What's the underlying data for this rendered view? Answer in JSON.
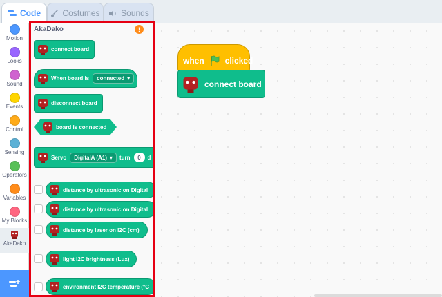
{
  "tabs": [
    {
      "label": "Code",
      "icon": "code-icon",
      "active": true
    },
    {
      "label": "Costumes",
      "icon": "brush-icon",
      "active": false
    },
    {
      "label": "Sounds",
      "icon": "speaker-icon",
      "active": false
    }
  ],
  "categories": [
    {
      "label": "Motion",
      "color": "#4c97ff"
    },
    {
      "label": "Looks",
      "color": "#9966ff"
    },
    {
      "label": "Sound",
      "color": "#cf63cf"
    },
    {
      "label": "Events",
      "color": "#ffd500"
    },
    {
      "label": "Control",
      "color": "#ffab19"
    },
    {
      "label": "Sensing",
      "color": "#5cb1d6"
    },
    {
      "label": "Operators",
      "color": "#59c059"
    },
    {
      "label": "Variables",
      "color": "#ff8c1a"
    },
    {
      "label": "My Blocks",
      "color": "#ff6680"
    },
    {
      "label": "AkaDako",
      "icon": "robot-icon",
      "selected": true
    }
  ],
  "palette": {
    "title": "AkaDako",
    "warning_symbol": "!",
    "blocks": {
      "connect": "connect board",
      "when_board": "When board is",
      "when_board_value": "connected",
      "disconnect": "disconnect board",
      "is_connected": "board is connected",
      "servo": "Servo",
      "servo_port": "DigitalA (A1)",
      "servo_turn": "turn",
      "servo_value": "0",
      "servo_suffix": "d",
      "ultrasonic_1": "distance by ultrasonic on Digital",
      "ultrasonic_2": "distance by ultrasonic on Digital",
      "laser": "distance by laser on I2C (cm)",
      "light": "light I2C brightness (Lux)",
      "environment": "environment I2C temperature (°C"
    }
  },
  "workspace": {
    "hat_when": "when",
    "hat_clicked": "clicked",
    "block_label": "connect board"
  },
  "colors": {
    "accent": "#4c97ff",
    "extension_green": "#0fbd8c",
    "events_yellow": "#ffbf00",
    "highlight_red": "#e60012"
  }
}
